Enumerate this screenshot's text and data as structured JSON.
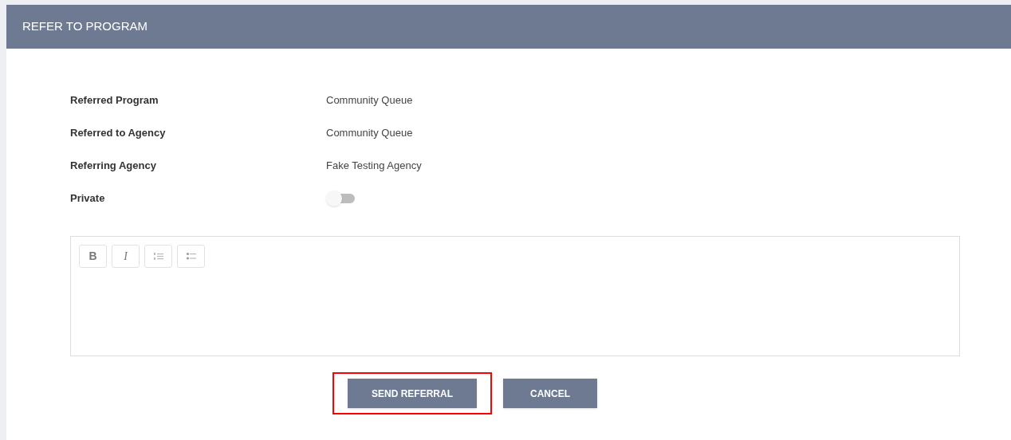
{
  "header": {
    "title": "REFER TO PROGRAM"
  },
  "fields": [
    {
      "label": "Referred Program",
      "kind": "text",
      "value": "Community Queue"
    },
    {
      "label": "Referred to Agency",
      "kind": "text",
      "value": "Community Queue"
    },
    {
      "label": "Referring Agency",
      "kind": "text",
      "value": "Fake Testing Agency"
    },
    {
      "label": "Private",
      "kind": "toggle",
      "on": false
    }
  ],
  "editor": {
    "toolbar": [
      {
        "kind": "bold",
        "label": "B"
      },
      {
        "kind": "italic",
        "label": "I"
      },
      {
        "kind": "numbered-list"
      },
      {
        "kind": "bulleted-list"
      }
    ]
  },
  "buttons": [
    {
      "label": "SEND REFERRAL",
      "highlighted": true
    },
    {
      "label": "CANCEL",
      "highlighted": false
    }
  ]
}
